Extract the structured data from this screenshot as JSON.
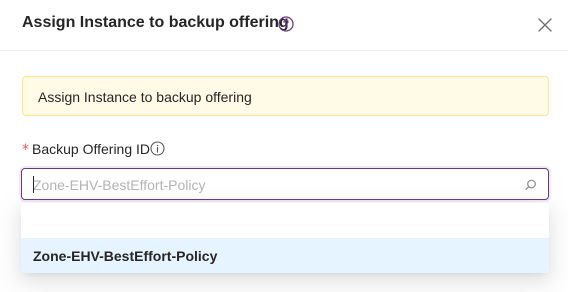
{
  "modal": {
    "title": "Assign Instance to backup offering",
    "alert_text": "Assign Instance to backup offering"
  },
  "form": {
    "required_mark": "*",
    "label": "Backup Offering ID",
    "placeholder": "Zone-EHV-BestEffort-Policy",
    "value": ""
  },
  "dropdown": {
    "options": [
      {
        "label": ""
      },
      {
        "label": "Zone-EHV-BestEffort-Policy"
      }
    ]
  },
  "colors": {
    "accent": "#6b3a85",
    "alert_bg": "#fffbe6",
    "alert_border": "#ffe58f",
    "option_active_bg": "#e6f4ff",
    "required": "#ff4d4f"
  },
  "icons": {
    "help": "question-circle-icon",
    "close": "close-icon",
    "info": "info-circle-icon",
    "search": "search-icon"
  }
}
